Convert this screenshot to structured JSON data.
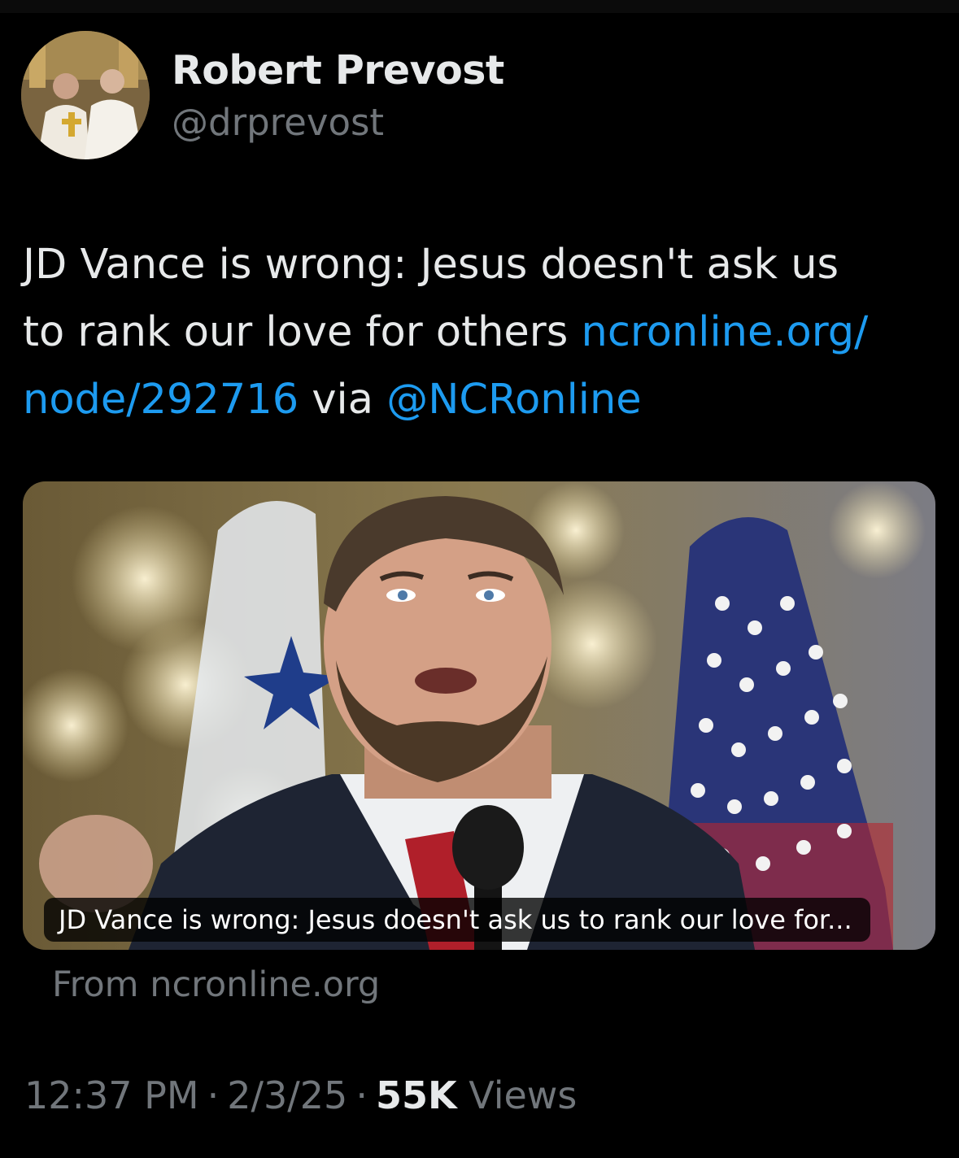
{
  "tweet": {
    "author": {
      "display_name": "Robert Prevost",
      "handle": "@drprevost",
      "avatar_icon": "avatar-photo"
    },
    "text": {
      "line1": "JD Vance is wrong: Jesus doesn't ask us",
      "line2_plain": "to rank our love for others ",
      "link_part1": "ncronline.org/",
      "link_part2": "node/292716",
      "via_text": " via ",
      "mention": "@NCRonline"
    },
    "card": {
      "title": "JD Vance is wrong: Jesus doesn't ask us to rank our love for...",
      "source": "From ncronline.org"
    },
    "meta": {
      "time": "12:37 PM",
      "separator": "·",
      "date": "2/3/25",
      "views_count": "55K",
      "views_label": "Views"
    }
  },
  "colors": {
    "background": "#000000",
    "text_primary": "#e7e9ea",
    "text_secondary": "#71767b",
    "link": "#1d9bf0"
  }
}
